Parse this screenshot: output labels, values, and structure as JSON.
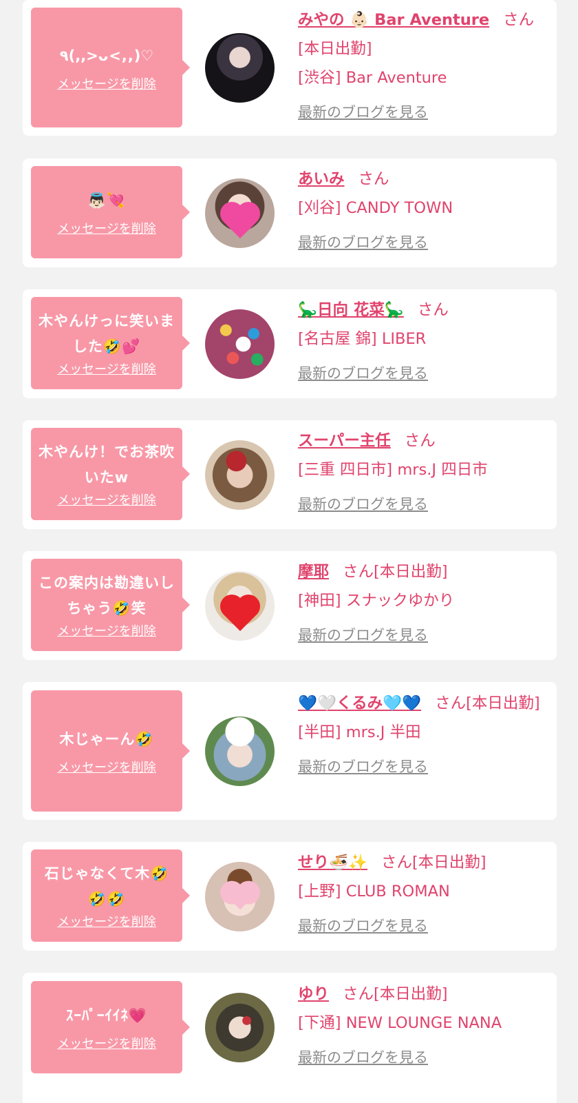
{
  "delete_label": "メッセージを削除",
  "san_suffix": "さん",
  "blog_link": "最新のブログを見る",
  "colors": {
    "bubble": "#f898a7",
    "name": "#e0436c",
    "blog": "#8c8c8c",
    "background": "#f2f2f2"
  },
  "entries": [
    {
      "message": "٩(,,>ᴗ<,,)♡",
      "name": "みやの 👶🏻 Bar Aventure",
      "suffix": "さん",
      "status": "[本日出勤]",
      "location": "[渋谷] Bar Aventure",
      "avatar_icon": "woman-dark-outfit-photo"
    },
    {
      "message": "👼🏻💘",
      "name": "あいみ",
      "suffix": "さん",
      "status": "",
      "location": "[刈谷] CANDY TOWN",
      "avatar_icon": "woman-pink-heart-photo"
    },
    {
      "message": "木やんけっに笑いました🤣💕",
      "name": "🦕日向 花菜🦕",
      "suffix": "さん",
      "status": "",
      "location": "[名古屋 錦] LIBER",
      "avatar_icon": "colorful-balls-photo"
    },
    {
      "message": "木やんけ！でお茶吹いたw",
      "name": "スーパー主任",
      "suffix": "さん",
      "status": "",
      "location": "[三重 四日市] mrs.J 四日市",
      "avatar_icon": "person-red-hair-photo"
    },
    {
      "message": "この案内は勘違いしちゃう🤣笑",
      "name": "摩耶",
      "suffix": "さん[本日出勤]",
      "status": "",
      "location": "[神田] スナックゆかり",
      "avatar_icon": "woman-red-heart-photo"
    },
    {
      "message": "木じゃーん🤣",
      "name": "💙🤍くるみ🩵💙",
      "suffix": "さん[本日出勤]",
      "status": "",
      "location": "[半田] mrs.J 半田",
      "avatar_icon": "woman-white-cap-photo"
    },
    {
      "message": "石じゃなくて木🤣🤣🤣",
      "name": "せり🍜✨",
      "suffix": "さん[本日出勤]",
      "status": "",
      "location": "[上野] CLUB ROMAN",
      "avatar_icon": "woman-short-hair-photo"
    },
    {
      "message": "ｽｰﾊﾟｰｲｲﾈ💗",
      "name": "ゆり",
      "suffix": "さん[本日出勤]",
      "status": "",
      "location": "[下通] NEW LOUNGE NANA",
      "avatar_icon": "woman-kimono-photo"
    }
  ]
}
